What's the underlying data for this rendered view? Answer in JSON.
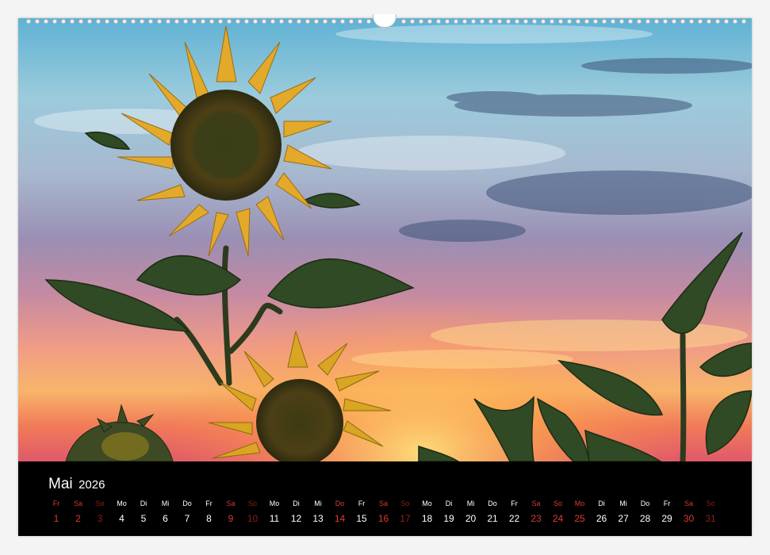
{
  "calendar": {
    "month": "Mai",
    "year": "2026",
    "days": [
      {
        "dow": "Fr",
        "num": "1",
        "kind": "hol"
      },
      {
        "dow": "Sa",
        "num": "2",
        "kind": "sat"
      },
      {
        "dow": "So",
        "num": "3",
        "kind": "sun"
      },
      {
        "dow": "Mo",
        "num": "4",
        "kind": ""
      },
      {
        "dow": "Di",
        "num": "5",
        "kind": ""
      },
      {
        "dow": "Mi",
        "num": "6",
        "kind": ""
      },
      {
        "dow": "Do",
        "num": "7",
        "kind": ""
      },
      {
        "dow": "Fr",
        "num": "8",
        "kind": ""
      },
      {
        "dow": "Sa",
        "num": "9",
        "kind": "sat"
      },
      {
        "dow": "So",
        "num": "10",
        "kind": "sun"
      },
      {
        "dow": "Mo",
        "num": "11",
        "kind": ""
      },
      {
        "dow": "Di",
        "num": "12",
        "kind": ""
      },
      {
        "dow": "Mi",
        "num": "13",
        "kind": ""
      },
      {
        "dow": "Do",
        "num": "14",
        "kind": "hol"
      },
      {
        "dow": "Fr",
        "num": "15",
        "kind": ""
      },
      {
        "dow": "Sa",
        "num": "16",
        "kind": "sat"
      },
      {
        "dow": "So",
        "num": "17",
        "kind": "sun"
      },
      {
        "dow": "Mo",
        "num": "18",
        "kind": ""
      },
      {
        "dow": "Di",
        "num": "19",
        "kind": ""
      },
      {
        "dow": "Mi",
        "num": "20",
        "kind": ""
      },
      {
        "dow": "Do",
        "num": "21",
        "kind": ""
      },
      {
        "dow": "Fr",
        "num": "22",
        "kind": ""
      },
      {
        "dow": "Sa",
        "num": "23",
        "kind": "sat"
      },
      {
        "dow": "So",
        "num": "24",
        "kind": "hol"
      },
      {
        "dow": "Mo",
        "num": "25",
        "kind": "hol"
      },
      {
        "dow": "Di",
        "num": "26",
        "kind": ""
      },
      {
        "dow": "Mi",
        "num": "27",
        "kind": ""
      },
      {
        "dow": "Do",
        "num": "28",
        "kind": ""
      },
      {
        "dow": "Fr",
        "num": "29",
        "kind": ""
      },
      {
        "dow": "Sa",
        "num": "30",
        "kind": "sat"
      },
      {
        "dow": "So",
        "num": "31",
        "kind": "sun"
      }
    ]
  },
  "colors": {
    "weekday": "#ffffff",
    "saturday": "#d83a2f",
    "sunday": "#8e1f1a",
    "holiday": "#e23b2f",
    "background": "#000000"
  }
}
